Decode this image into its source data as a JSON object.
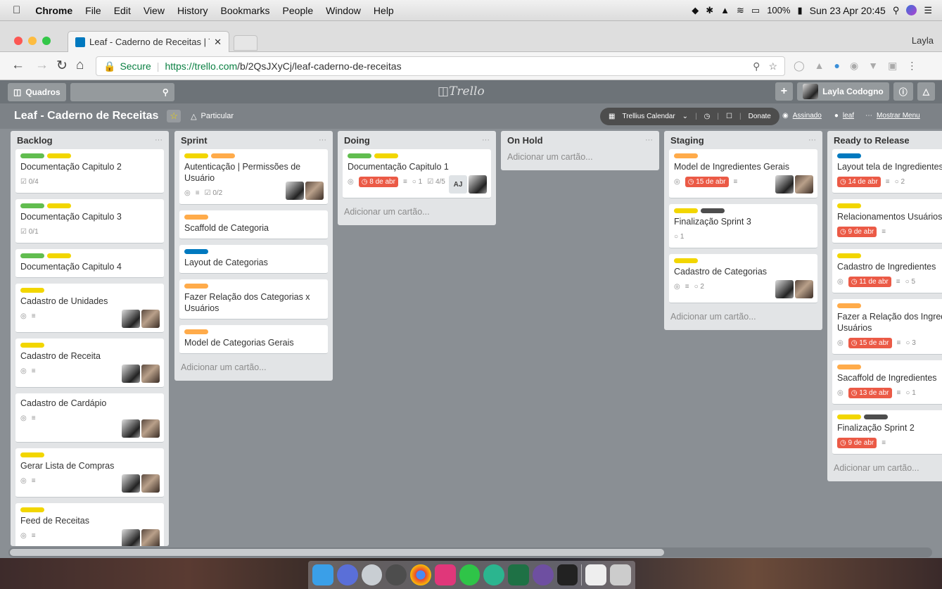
{
  "menubar": {
    "app": "Chrome",
    "items": [
      "File",
      "Edit",
      "View",
      "History",
      "Bookmarks",
      "People",
      "Window",
      "Help"
    ],
    "battery": "100%",
    "clock": "Sun 23 Apr  20:45"
  },
  "browser": {
    "tab_title": "Leaf - Caderno de Receitas | T",
    "profile": "Layla",
    "secure_label": "Secure",
    "url_host": "https://trello.com",
    "url_path": "/b/2QsJXyCj/leaf-caderno-de-receitas"
  },
  "trello": {
    "boards_label": "Quadros",
    "logo": "Trello",
    "user_name": "Layla Codogno"
  },
  "board": {
    "title": "Leaf - Caderno de Receitas",
    "visibility": "Particular",
    "powerup": "Trellius Calendar",
    "donate": "Donate",
    "subscribed": "Assinado",
    "github": "leaf",
    "show_menu": "Mostrar Menu"
  },
  "add_card_label": "Adicionar um cartão...",
  "colors": {
    "green": "#61bd4f",
    "yellow": "#f2d600",
    "orange": "#ffab4a",
    "blue": "#0079bf",
    "black": "#4d4d4d",
    "red": "#eb5a46"
  },
  "lists": [
    {
      "name": "Backlog",
      "cards": [
        {
          "labels": [
            "green",
            "yellow"
          ],
          "title": "Documentação Capitulo 2",
          "checklist": "0/4"
        },
        {
          "labels": [
            "green",
            "yellow"
          ],
          "title": "Documentação Capitulo 3",
          "checklist": "0/1"
        },
        {
          "labels": [
            "green",
            "yellow"
          ],
          "title": "Documentação Capitulo 4"
        },
        {
          "labels": [
            "yellow"
          ],
          "title": "Cadastro de Unidades",
          "watch": true,
          "desc": true,
          "avatars": [
            "bw",
            "color"
          ]
        },
        {
          "labels": [
            "yellow"
          ],
          "title": "Cadastro de Receita",
          "watch": true,
          "desc": true,
          "avatars": [
            "bw",
            "color"
          ]
        },
        {
          "labels": [],
          "title": "Cadastro de Cardápio",
          "watch": true,
          "desc": true,
          "avatars": [
            "bw",
            "color"
          ]
        },
        {
          "labels": [
            "yellow"
          ],
          "title": "Gerar Lista de Compras",
          "watch": true,
          "desc": true,
          "avatars": [
            "bw",
            "color"
          ]
        },
        {
          "labels": [
            "yellow"
          ],
          "title": "Feed de Receitas",
          "watch": true,
          "desc": true,
          "avatars": [
            "bw",
            "color"
          ]
        }
      ]
    },
    {
      "name": "Sprint",
      "cards": [
        {
          "labels": [
            "yellow",
            "orange"
          ],
          "title": "Autenticação | Permissões de Usuário",
          "watch": true,
          "desc": true,
          "checklist": "0/2",
          "avatars": [
            "bw",
            "color"
          ]
        },
        {
          "labels": [
            "orange"
          ],
          "title": "Scaffold de Categoria"
        },
        {
          "labels": [
            "blue"
          ],
          "title": "Layout de Categorias"
        },
        {
          "labels": [
            "orange"
          ],
          "title": "Fazer Relação dos Categorias x Usuários"
        },
        {
          "labels": [
            "orange"
          ],
          "title": "Model de Categorias Gerais"
        }
      ]
    },
    {
      "name": "Doing",
      "cards": [
        {
          "labels": [
            "green",
            "yellow"
          ],
          "title": "Documentação Capitulo 1",
          "watch": true,
          "due": "8 de abr",
          "desc": true,
          "comments": "1",
          "checklist": "4/5",
          "avatars": [
            "aj",
            "bw"
          ]
        }
      ]
    },
    {
      "name": "On Hold",
      "cards": []
    },
    {
      "name": "Staging",
      "cards": [
        {
          "labels": [
            "orange"
          ],
          "title": "Model de Ingredientes Gerais",
          "watch": true,
          "due": "15 de abr",
          "desc": true,
          "avatars": [
            "bw",
            "color"
          ]
        },
        {
          "labels": [
            "yellow",
            "black"
          ],
          "title": "Finalização Sprint 3",
          "comments": "1"
        },
        {
          "labels": [
            "yellow"
          ],
          "title": "Cadastro de Categorias",
          "watch": true,
          "desc": true,
          "comments": "2",
          "avatars": [
            "bw",
            "color"
          ]
        }
      ]
    },
    {
      "name": "Ready to Release",
      "cards": [
        {
          "labels": [
            "blue"
          ],
          "title": "Layout tela de Ingredientes",
          "due": "14 de abr",
          "desc": true,
          "comments": "2"
        },
        {
          "labels": [
            "yellow"
          ],
          "title": "Relacionamentos Usuários",
          "due": "9 de abr",
          "desc": true
        },
        {
          "labels": [
            "yellow"
          ],
          "title": "Cadastro de Ingredientes",
          "watch": true,
          "due": "11 de abr",
          "desc": true,
          "comments": "5"
        },
        {
          "labels": [
            "orange"
          ],
          "title": "Fazer a Relação dos Ingredi Usuários",
          "watch": true,
          "due": "15 de abr",
          "desc": true,
          "comments": "3"
        },
        {
          "labels": [
            "orange"
          ],
          "title": "Sacaffold de Ingredientes",
          "watch": true,
          "due": "13 de abr",
          "desc": true,
          "comments": "1"
        },
        {
          "labels": [
            "yellow",
            "black"
          ],
          "title": "Finalização Sprint 2",
          "due": "9 de abr",
          "desc": true
        }
      ]
    }
  ]
}
